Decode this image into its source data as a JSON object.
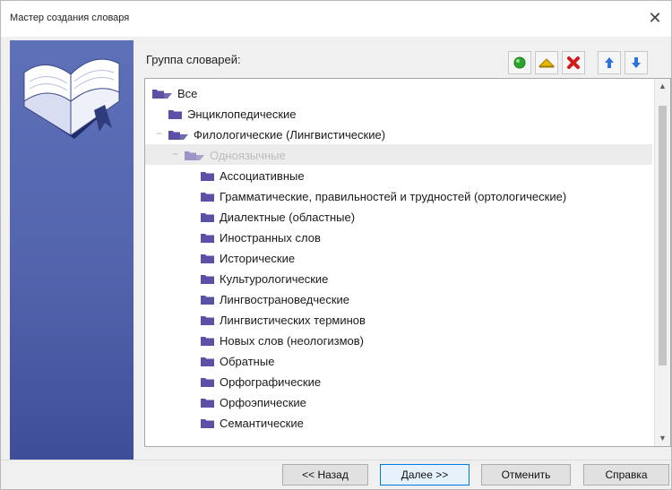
{
  "window": {
    "title": "Мастер создания словаря",
    "close_glyph": "✕"
  },
  "banner": {
    "icon": "open-book-icon"
  },
  "header": {
    "group_label": "Группа словарей:"
  },
  "toolbar": [
    {
      "name": "add-icon",
      "color": "#2da52d"
    },
    {
      "name": "edit-icon",
      "color": "#d9a400"
    },
    {
      "name": "delete-icon",
      "color": "#d41b1b"
    },
    {
      "name": "move-up-icon",
      "color": "#2c74d6"
    },
    {
      "name": "move-down-icon",
      "color": "#2c74d6"
    }
  ],
  "tree": {
    "nodes": [
      {
        "label": "Все",
        "level": 0,
        "open": true,
        "expander": ""
      },
      {
        "label": "Энциклопедические",
        "level": 1,
        "open": false,
        "expander": ""
      },
      {
        "label": "Филологические (Лингвистические)",
        "level": 1,
        "open": true,
        "expander": "−"
      },
      {
        "label": "Одноязычные",
        "level": 2,
        "open": true,
        "expander": "−",
        "grayed": true,
        "selected": true
      },
      {
        "label": "Ассоциативные",
        "level": 3,
        "open": false,
        "expander": ""
      },
      {
        "label": "Грамматические, правильностей и трудностей (ортологические)",
        "level": 3,
        "open": false,
        "expander": ""
      },
      {
        "label": "Диалектные (областные)",
        "level": 3,
        "open": false,
        "expander": ""
      },
      {
        "label": "Иностранных слов",
        "level": 3,
        "open": false,
        "expander": ""
      },
      {
        "label": "Исторические",
        "level": 3,
        "open": false,
        "expander": ""
      },
      {
        "label": "Культурологические",
        "level": 3,
        "open": false,
        "expander": ""
      },
      {
        "label": "Лингвострановедческие",
        "level": 3,
        "open": false,
        "expander": ""
      },
      {
        "label": "Лингвистических терминов",
        "level": 3,
        "open": false,
        "expander": ""
      },
      {
        "label": "Новых слов (неологизмов)",
        "level": 3,
        "open": false,
        "expander": ""
      },
      {
        "label": "Обратные",
        "level": 3,
        "open": false,
        "expander": ""
      },
      {
        "label": "Орфографические",
        "level": 3,
        "open": false,
        "expander": ""
      },
      {
        "label": "Орфоэпические",
        "level": 3,
        "open": false,
        "expander": ""
      },
      {
        "label": "Семантические",
        "level": 3,
        "open": false,
        "expander": ""
      }
    ],
    "scroll": {
      "up": "▲",
      "down": "▼"
    }
  },
  "buttons": {
    "back": "<< Назад",
    "next": "Далее >>",
    "cancel": "Отменить",
    "help": "Справка"
  },
  "colors": {
    "folder": "#5a50a5",
    "banner": "#5364ad",
    "accent": "#0078d7"
  }
}
